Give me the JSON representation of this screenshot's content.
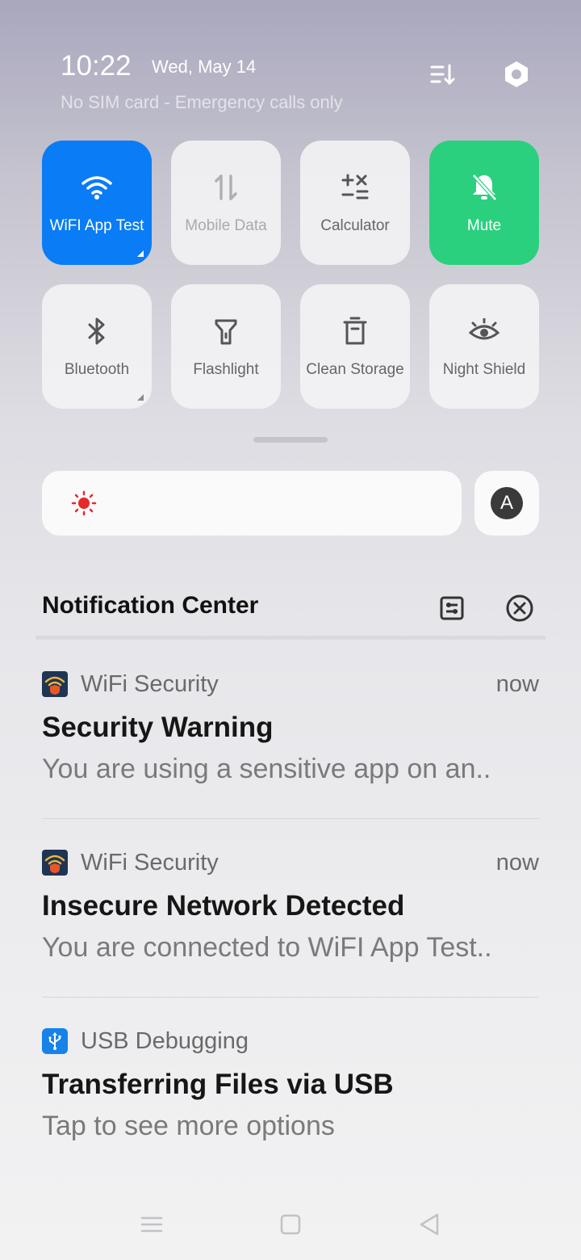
{
  "status": {
    "time": "10:22",
    "date": "Wed, May 14",
    "carrier": "No SIM card - Emergency calls only"
  },
  "tiles": [
    {
      "label": "WiFI App Test",
      "icon": "wifi-icon",
      "state": "on",
      "color": "#0a7cf5"
    },
    {
      "label": "Mobile Data",
      "icon": "mobile-data-icon",
      "state": "disabled"
    },
    {
      "label": "Calculator",
      "icon": "calculator-icon",
      "state": "off"
    },
    {
      "label": "Mute",
      "icon": "bell-off-icon",
      "state": "on",
      "color": "#2bd07f"
    },
    {
      "label": "Bluetooth",
      "icon": "bluetooth-icon",
      "state": "off"
    },
    {
      "label": "Flashlight",
      "icon": "flashlight-icon",
      "state": "off"
    },
    {
      "label": "Clean Storage",
      "icon": "clean-storage-icon",
      "state": "off"
    },
    {
      "label": "Night Shield",
      "icon": "eye-icon",
      "state": "off"
    }
  ],
  "brightness": {
    "icon": "sun-icon",
    "auto_label": "A"
  },
  "notification_center": {
    "title": "Notification Center"
  },
  "notifications": [
    {
      "app": "WiFi Security",
      "time": "now",
      "title": "Security Warning",
      "body": "You are using a sensitive app on an.."
    },
    {
      "app": "WiFi Security",
      "time": "now",
      "title": "Insecure Network Detected",
      "body": "You are connected to WiFI App Test.."
    },
    {
      "app": "USB Debugging",
      "time": "",
      "title": "Transferring Files via USB",
      "body": "Tap to see more options"
    }
  ],
  "colors": {
    "accent_blue": "#0a7cf5",
    "mute_green": "#2bd07f",
    "sun_red": "#e8282b"
  }
}
